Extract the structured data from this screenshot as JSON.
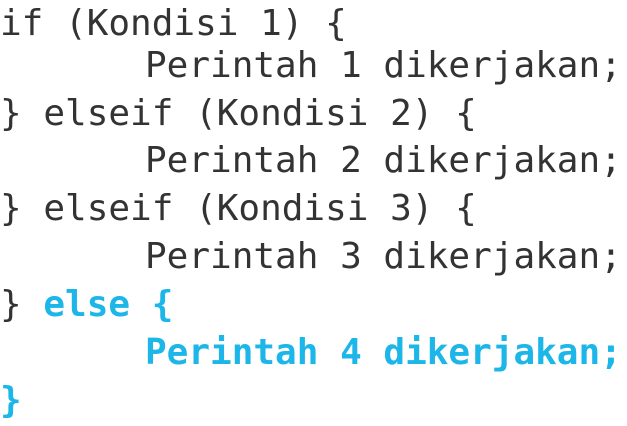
{
  "code": {
    "lines": [
      {
        "text": "if (Kondisi 1) {"
      },
      {
        "text": "Perintah 1 dikerjakan;"
      },
      {
        "text": "} elseif (Kondisi 2) {"
      },
      {
        "text": "Perintah 2 dikerjakan;"
      },
      {
        "text": "} elseif (Kondisi 3) {"
      },
      {
        "text": "Perintah 3 dikerjakan;"
      },
      {
        "prefix": "} ",
        "highlight": "else {"
      },
      {
        "highlight": "Perintah 4 dikerjakan;"
      },
      {
        "highlight": "}"
      }
    ],
    "colors": {
      "text": "#333333",
      "highlight": "#1cb6e8",
      "background": "#ffffff"
    }
  }
}
